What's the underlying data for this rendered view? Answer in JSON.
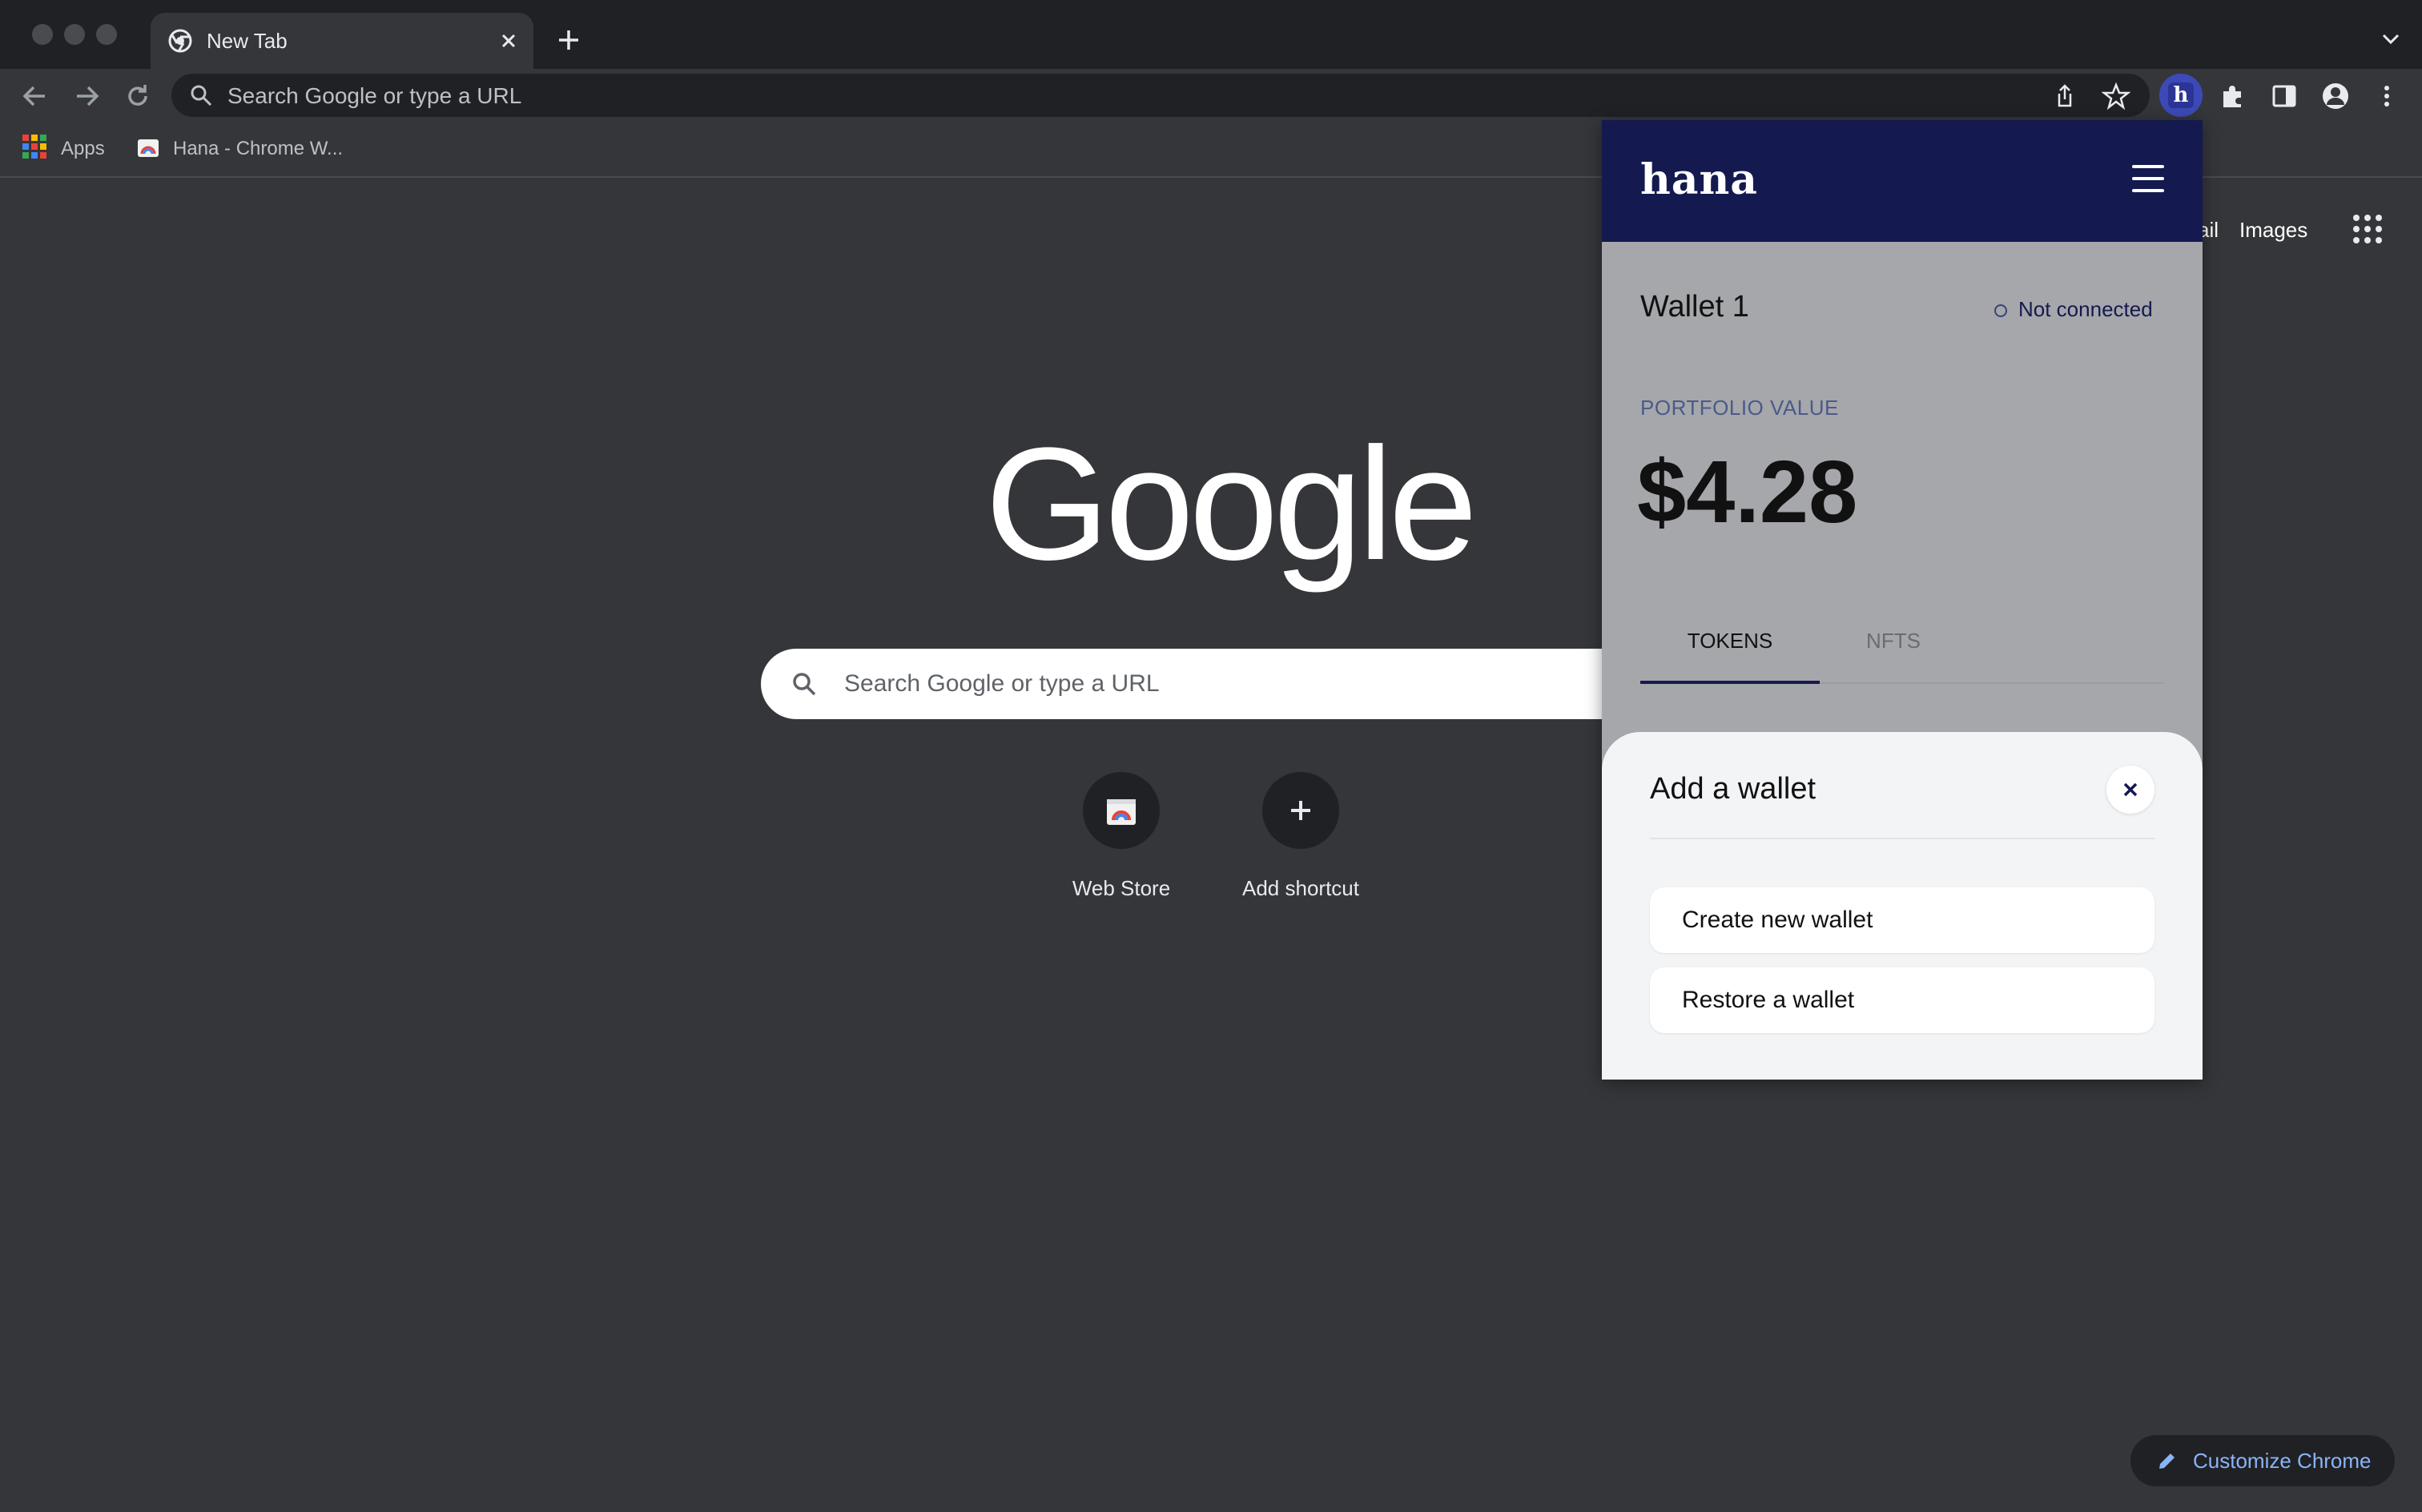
{
  "browser": {
    "tab": {
      "title": "New Tab"
    },
    "omnibox": {
      "placeholder": "Search Google or type a URL"
    },
    "bookmarks": [
      {
        "label": "Apps"
      },
      {
        "label": "Hana - Chrome W..."
      }
    ]
  },
  "ntp": {
    "top_links": {
      "gmail_partial": "ail",
      "images": "Images"
    },
    "logo": "Google",
    "search_placeholder": "Search Google or type a URL",
    "shortcuts": [
      {
        "label": "Web Store",
        "icon": "web-store-icon"
      },
      {
        "label": "Add shortcut",
        "icon": "plus-icon"
      }
    ],
    "customize_label": "Customize Chrome"
  },
  "hana": {
    "logo": "hana",
    "wallet_name": "Wallet 1",
    "connection_status": "Not connected",
    "portfolio_label": "PORTFOLIO VALUE",
    "portfolio_value": "$4.28",
    "tabs": [
      {
        "label": "TOKENS",
        "active": true
      },
      {
        "label": "NFTS",
        "active": false
      }
    ],
    "sheet": {
      "title": "Add a wallet",
      "options": [
        {
          "label": "Create new wallet"
        },
        {
          "label": "Restore a wallet"
        }
      ]
    }
  },
  "colors": {
    "chrome_dark": "#202124",
    "ntp_background": "#35363a",
    "hana_navy": "#141a4f",
    "popup_grey": "#a6a7ab",
    "link_blue": "#8ab4f8"
  }
}
